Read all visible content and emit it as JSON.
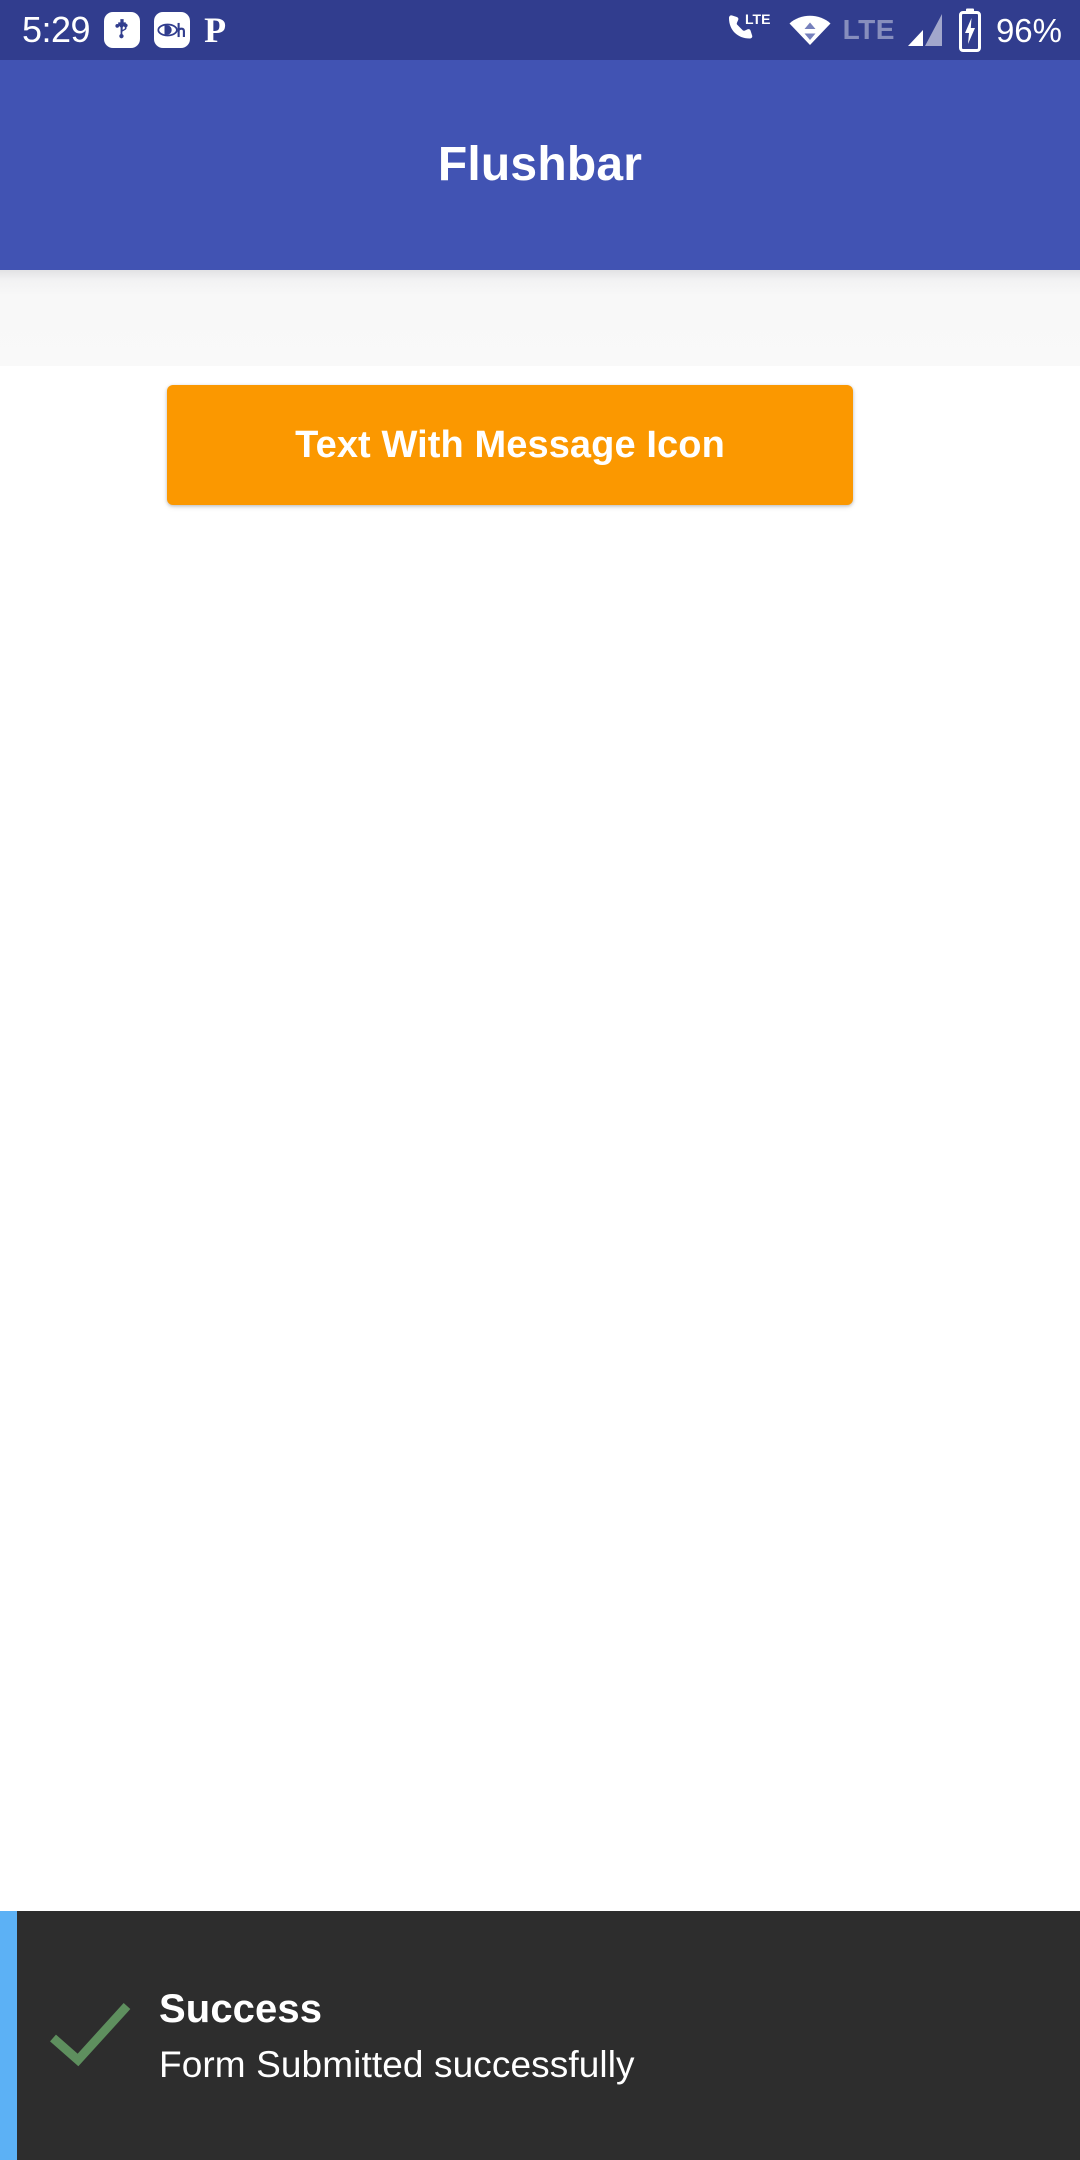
{
  "status_bar": {
    "background_color": "#313D8E",
    "clock": "5:29",
    "battery_percent": "96%",
    "left_icons": [
      {
        "name": "usb-icon",
        "label": "USB"
      },
      {
        "name": "disney-hotstar-icon",
        "label": "Dh"
      },
      {
        "name": "phonepe-icon",
        "label": "P"
      }
    ],
    "right_icons": [
      {
        "name": "volte-icon",
        "label": "LTE"
      },
      {
        "name": "wifi-icon",
        "label": "Wi-Fi"
      },
      {
        "name": "lte-label-icon",
        "label": "LTE"
      },
      {
        "name": "cellular-signal-icon",
        "label": "Signal"
      },
      {
        "name": "battery-charging-icon",
        "label": "Charging"
      }
    ]
  },
  "app_bar": {
    "title": "Flushbar",
    "background_color": "#4153B3"
  },
  "main": {
    "background_color": "#FFFFFF",
    "buttons": [
      {
        "name": "text-with-message-icon-button",
        "label": "Text With Message Icon",
        "background_color": "#FB9800",
        "text_color": "#FFFFFF"
      }
    ]
  },
  "flushbar": {
    "title": "Success",
    "message": "Form Submitted successfully",
    "background_color": "#2D2D2D",
    "left_indicator_color": "#5CB1F5",
    "icon": "check-circle-icon",
    "icon_color": "#5E8F5E",
    "title_color": "#FFFFFF",
    "message_color": "#FFFFFF"
  }
}
